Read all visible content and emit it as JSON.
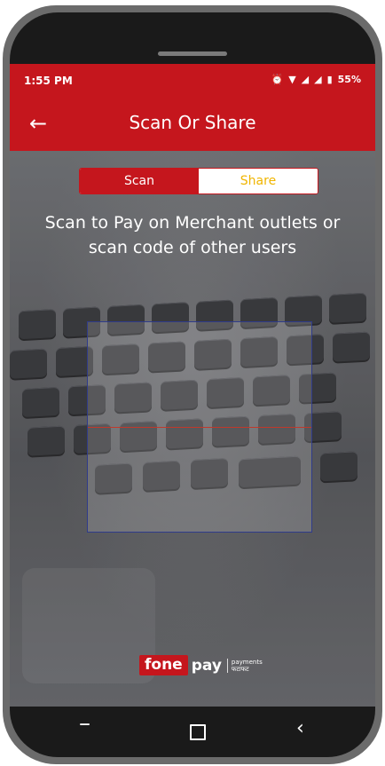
{
  "status_bar": {
    "time": "1:55 PM",
    "battery": "55%"
  },
  "app_bar": {
    "title": "Scan Or Share",
    "back_icon": "arrow-left-icon"
  },
  "tabs": [
    {
      "label": "Scan",
      "selected": true
    },
    {
      "label": "Share",
      "selected": false
    }
  ],
  "headline": "Scan to Pay on Merchant outlets or scan code of other users",
  "brand": {
    "fone": "fone",
    "pay": "pay",
    "sub_top": "payments",
    "sub_bottom": "फटाफट"
  },
  "colors": {
    "accent": "#c5161d",
    "share_text": "#f0b500",
    "scan_frame": "#2f3b8a"
  }
}
